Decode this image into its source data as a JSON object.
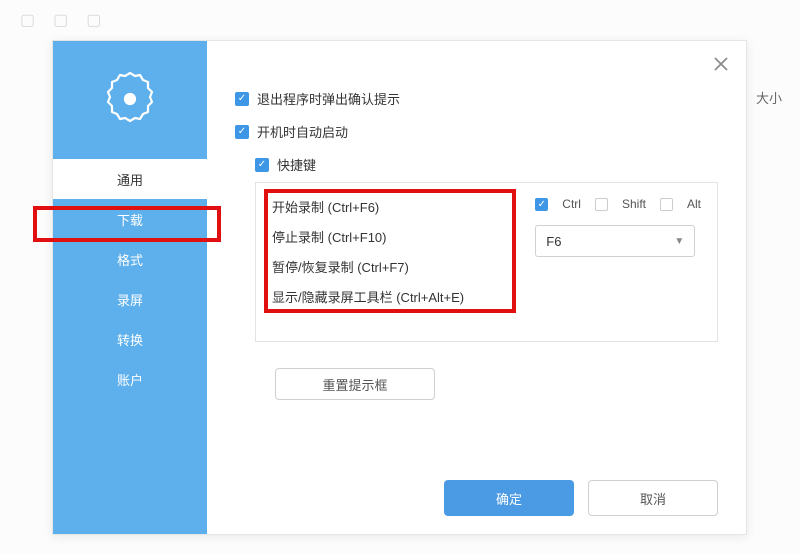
{
  "background": {
    "size_header": "大小"
  },
  "sidebar": {
    "items": [
      {
        "label": "通用",
        "active": true
      },
      {
        "label": "下载",
        "active": false
      },
      {
        "label": "格式",
        "active": false
      },
      {
        "label": "录屏",
        "active": false
      },
      {
        "label": "转换",
        "active": false
      },
      {
        "label": "账户",
        "active": false
      }
    ]
  },
  "content": {
    "exit_confirm_label": "退出程序时弹出确认提示",
    "startup_label": "开机时自动启动",
    "hotkey_label": "快捷键",
    "hotkeys": [
      "开始录制 (Ctrl+F6)",
      "停止录制 (Ctrl+F10)",
      "暂停/恢复录制 (Ctrl+F7)",
      "显示/隐藏录屏工具栏 (Ctrl+Alt+E)"
    ],
    "modifiers": {
      "ctrl_label": "Ctrl",
      "ctrl_checked": true,
      "shift_label": "Shift",
      "shift_checked": false,
      "alt_label": "Alt",
      "alt_checked": false
    },
    "key_select_value": "F6",
    "reset_label": "重置提示框"
  },
  "footer": {
    "ok_label": "确定",
    "cancel_label": "取消"
  }
}
